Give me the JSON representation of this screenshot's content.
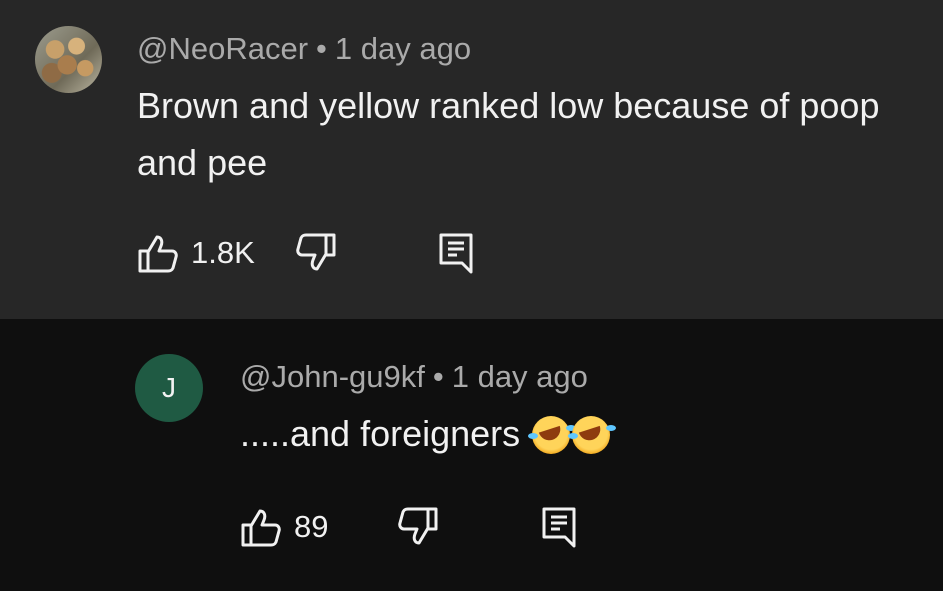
{
  "comments": [
    {
      "author": "@NeoRacer",
      "separator": "•",
      "time": "1 day ago",
      "text": "Brown and yellow ranked low because of poop and pee",
      "likes": "1.8K"
    },
    {
      "author": "@John-gu9kf",
      "avatar_letter": "J",
      "separator": "•",
      "time": "1 day ago",
      "text": ".....and foreigners",
      "likes": "89"
    }
  ],
  "colors": {
    "main_background": "#272727",
    "reply_background": "#0f0f0f",
    "avatar_reply": "#1f5a43",
    "text": "#f1f1f1",
    "meta_text": "#aaaaaa"
  },
  "icons": {
    "like": "thumbs-up-icon",
    "dislike": "thumbs-down-icon",
    "reply": "comment-icon",
    "emoji": "rolling-on-floor-laughing-emoji"
  }
}
